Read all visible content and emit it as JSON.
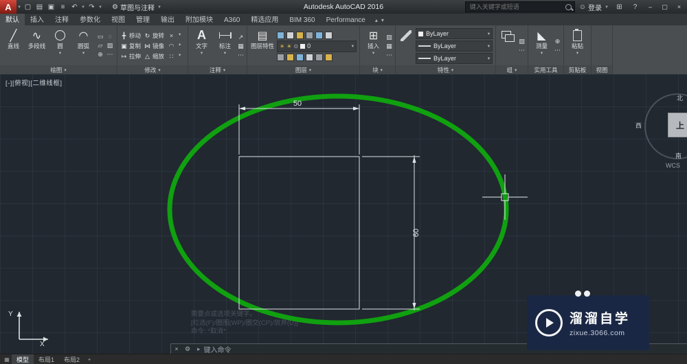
{
  "titlebar": {
    "logo_letter": "A",
    "title": "Autodesk AutoCAD 2016",
    "workspace": "草图与注释",
    "search_placeholder": "键入关键字或短语",
    "signin": "登录"
  },
  "icons": {
    "dropdown": "▾",
    "new_file": "▢",
    "open_file": "▤",
    "save_file": "▣",
    "plot": "≡",
    "undo": "↶",
    "redo": "↷",
    "gear": "⚙",
    "user": "☺",
    "apps": "⊞",
    "help": "?",
    "win_min": "–",
    "win_max": "▢",
    "win_close": "×",
    "ribbon_min": "▴",
    "line": "╱",
    "polyline": "∿",
    "arc": "◠",
    "move": "╋",
    "rotate": "↻",
    "copy": "▣",
    "mirror": "⋈",
    "stretch": "↦",
    "scale": "△",
    "trim": "×",
    "fillet": "◠",
    "array": "∷",
    "text_tool": "A",
    "leader": "↗",
    "table": "▦",
    "more": "⋯",
    "bulb": "☀",
    "freeze": "⊙",
    "insert_block": "⊞",
    "block_edit": "▨",
    "measure": "◣",
    "point": "⊕",
    "mini_rect": "▭",
    "mini_ellipse": "◌",
    "mini_poly": "▱",
    "mini_hatch": "▨",
    "prompt": "▸",
    "model_grid": "▦",
    "plus": "+",
    "close_small": "×"
  },
  "ribbon": {
    "tabs": [
      "默认",
      "插入",
      "注释",
      "参数化",
      "视图",
      "管理",
      "输出",
      "附加模块",
      "A360",
      "精选应用",
      "BIM 360",
      "Performance"
    ],
    "draw": {
      "label": "绘图",
      "line": "直线",
      "polyline": "多段线",
      "circle": "圆",
      "arc": "圆弧"
    },
    "modify": {
      "label": "修改",
      "move": "移动",
      "rotate": "旋转",
      "copy": "复制",
      "mirror": "镜像",
      "stretch": "拉伸",
      "scale": "缩放"
    },
    "annotation": {
      "label": "注释",
      "text": "文字",
      "dimension": "标注"
    },
    "layers": {
      "label": "图层",
      "layer_properties": "图层特性",
      "current_layer": "0"
    },
    "block": {
      "label": "块",
      "insert": "插入"
    },
    "properties": {
      "label": "特性",
      "color": "ByLayer",
      "linetype": "ByLayer",
      "lineweight": "ByLayer"
    },
    "groups": {
      "label": "组"
    },
    "utilities": {
      "label": "实用工具",
      "measure": "测量"
    },
    "clipboard": {
      "label": "剪贴板",
      "paste": "粘贴"
    },
    "view": {
      "label": "视图"
    }
  },
  "viewport": {
    "label": "[-][俯视][二维线框]",
    "viewcube": {
      "north": "北",
      "west": "西",
      "south": "南",
      "top": "上",
      "wcs": "WCS"
    },
    "dim_width": "50",
    "dim_height": "60",
    "history": [
      "需要点或选项关键字。",
      "[栏选(F)/圈围(WP)/圈交(CP)/放弃(U)]:",
      "命令: *取消*"
    ]
  },
  "command_bar": {
    "prompt": "键入命令"
  },
  "layout_bar": {
    "model": "模型",
    "layout1": "布局1",
    "layout2": "布局2"
  },
  "watermark": {
    "title": "溜溜自学",
    "url": "zixue.3066.com"
  },
  "colors": {
    "ellipse": "#10A010",
    "background": "#212830",
    "dim": "#E8ECEF"
  }
}
